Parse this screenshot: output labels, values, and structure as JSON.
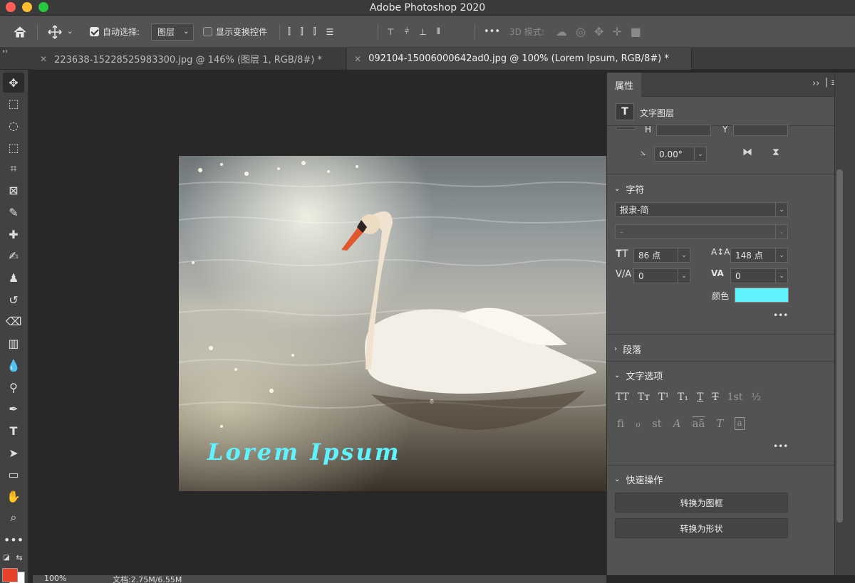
{
  "window": {
    "title": "Adobe Photoshop 2020"
  },
  "options_bar": {
    "auto_select_label": "自动选择:",
    "auto_select_value": "图层",
    "show_transform_label": "显示变换控件",
    "more": "•••",
    "mode_3d_label": "3D 模式:"
  },
  "tabs": [
    {
      "label": "223638-15228525983300.jpg @ 146% (图层 1, RGB/8#) *"
    },
    {
      "label": "092104-15006000642ad0.jpg @ 100% (Lorem Ipsum, RGB/8#) *"
    }
  ],
  "canvas": {
    "text_layer": "Lorem Ipsum"
  },
  "status": {
    "zoom": "100%",
    "doc": "文档:2.75M/6.55M"
  },
  "properties": {
    "tab": "属性",
    "layer_type": "文字图层",
    "h_label": "H",
    "y_label": "Y",
    "angle": "0.00°",
    "character": {
      "title": "字符",
      "font_family": "报隶-简",
      "font_style": "-",
      "size": "86 点",
      "leading": "148 点",
      "kerning": "0",
      "tracking": "0",
      "color_label": "颜色",
      "color": "#5ff3ff"
    },
    "paragraph": {
      "title": "段落"
    },
    "text_options": {
      "title": "文字选项",
      "row1": [
        "TT",
        "Tт",
        "T¹",
        "T₁",
        "T",
        "T",
        "1st",
        "½"
      ],
      "row2": [
        "fi",
        "ℴ",
        "st",
        "A",
        "aā",
        "T",
        "a"
      ]
    },
    "quick_actions": {
      "title": "快速操作",
      "convert_frame": "转换为图框",
      "convert_shape": "转换为形状"
    },
    "more": "•••"
  },
  "colors": {
    "foreground": "#e8432a",
    "background": "#ffffff"
  }
}
